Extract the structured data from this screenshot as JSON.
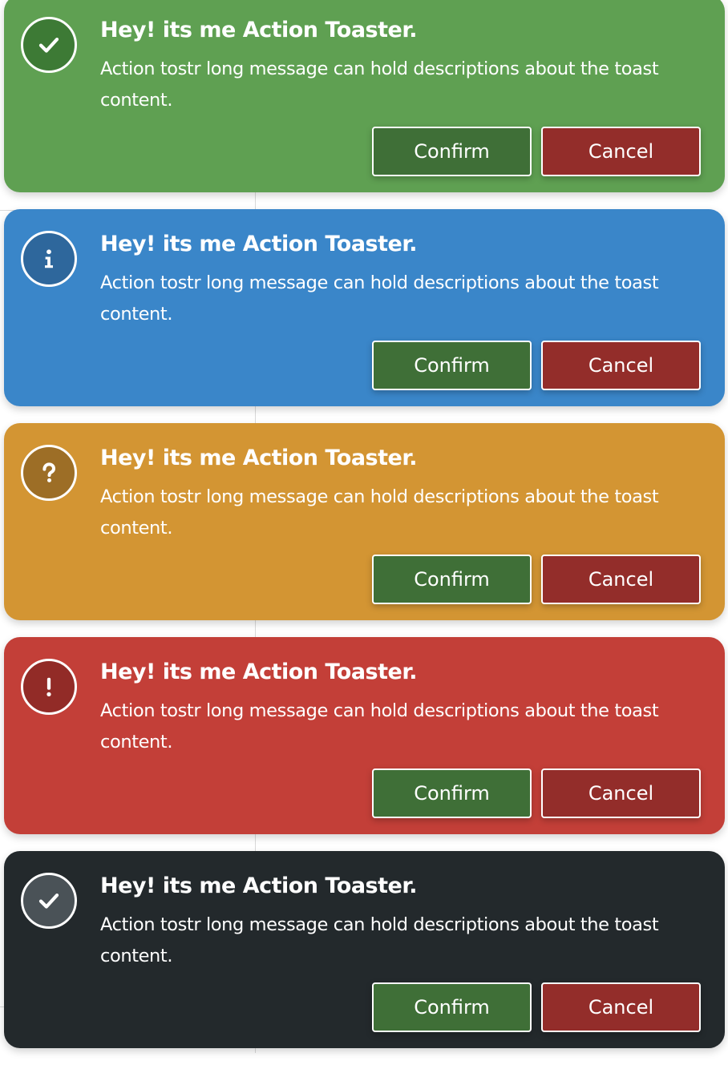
{
  "colors": {
    "success": "#5fa052",
    "info": "#3a86c9",
    "warning": "#d39533",
    "error": "#c33f38",
    "dark": "#23292c",
    "confirm_button": "#3f6f37",
    "cancel_button": "#932d2a"
  },
  "toasts": [
    {
      "type": "success",
      "icon": "check-icon",
      "title": "Hey! its me Action Toaster.",
      "message": "Action tostr long message can hold descriptions about the toast content.",
      "confirm_label": "Confirm",
      "cancel_label": "Cancel"
    },
    {
      "type": "info",
      "icon": "info-icon",
      "title": "Hey! its me Action Toaster.",
      "message": "Action tostr long message can hold descriptions about the toast content.",
      "confirm_label": "Confirm",
      "cancel_label": "Cancel"
    },
    {
      "type": "warning",
      "icon": "question-icon",
      "title": "Hey! its me Action Toaster.",
      "message": "Action tostr long message can hold descriptions about the toast content.",
      "confirm_label": "Confirm",
      "cancel_label": "Cancel"
    },
    {
      "type": "error",
      "icon": "exclamation-icon",
      "title": "Hey! its me Action Toaster.",
      "message": "Action tostr long message can hold descriptions about the toast content.",
      "confirm_label": "Confirm",
      "cancel_label": "Cancel"
    },
    {
      "type": "dark",
      "icon": "check-icon",
      "title": "Hey! its me Action Toaster.",
      "message": "Action tostr long message can hold descriptions about the toast content.",
      "confirm_label": "Confirm",
      "cancel_label": "Cancel"
    }
  ]
}
